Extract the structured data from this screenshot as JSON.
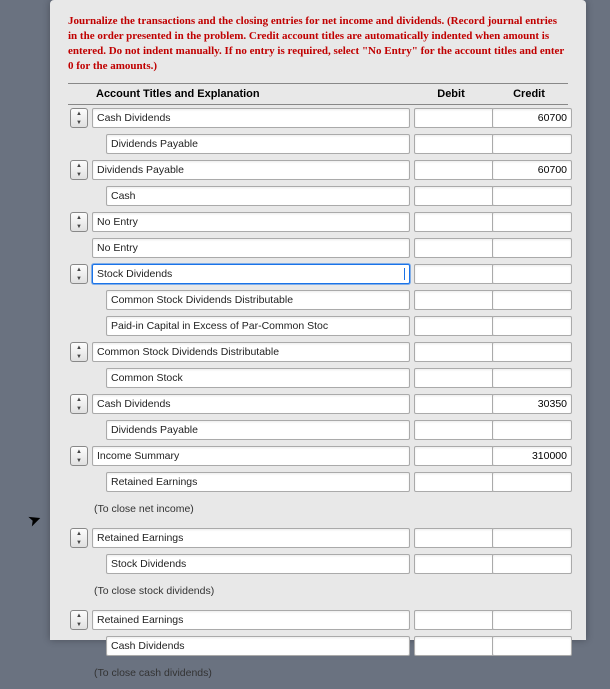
{
  "instructions": "Journalize the transactions and the closing entries for net income and dividends. (Record journal entries in the order presented in the problem. Credit account titles are automatically indented when amount is entered. Do not indent manually. If no entry is required, select \"No Entry\" for the account titles and enter 0 for the amounts.)",
  "headers": {
    "account": "Account Titles and Explanation",
    "debit": "Debit",
    "credit": "Credit"
  },
  "rows": [
    {
      "stepper": true,
      "account": "Cash Dividends",
      "debit": "",
      "credit": "60700"
    },
    {
      "stepper": false,
      "account": "Dividends Payable",
      "indent": true,
      "debit": "",
      "credit": ""
    },
    {
      "stepper": true,
      "account": "Dividends Payable",
      "debit": "",
      "credit": "60700"
    },
    {
      "stepper": false,
      "account": "Cash",
      "indent": true,
      "debit": "",
      "credit": ""
    },
    {
      "stepper": true,
      "account": "No Entry",
      "debit": "",
      "credit": ""
    },
    {
      "stepper": false,
      "account": "No Entry",
      "debit": "",
      "credit": ""
    },
    {
      "stepper": true,
      "account": "Stock Dividends",
      "debit": "",
      "credit": "",
      "focus": true
    },
    {
      "stepper": false,
      "account": "Common Stock Dividends Distributable",
      "indent": true,
      "debit": "",
      "credit": ""
    },
    {
      "stepper": false,
      "account": "Paid-in Capital in Excess of Par-Common Stoc",
      "indent": true,
      "debit": "",
      "credit": ""
    },
    {
      "stepper": true,
      "account": "Common Stock Dividends Distributable",
      "debit": "",
      "credit": ""
    },
    {
      "stepper": false,
      "account": "Common Stock",
      "indent": true,
      "debit": "",
      "credit": ""
    },
    {
      "stepper": true,
      "account": "Cash Dividends",
      "debit": "",
      "credit": "30350"
    },
    {
      "stepper": false,
      "account": "Dividends Payable",
      "indent": true,
      "debit": "",
      "credit": ""
    },
    {
      "stepper": true,
      "account": "Income Summary",
      "debit": "",
      "credit": "310000"
    },
    {
      "stepper": false,
      "account": "Retained Earnings",
      "indent": true,
      "debit": "",
      "credit": ""
    },
    {
      "memo": "(To close net income)"
    },
    {
      "stepper": true,
      "account": "Retained Earnings",
      "debit": "",
      "credit": ""
    },
    {
      "stepper": false,
      "account": "Stock Dividends",
      "indent": true,
      "debit": "",
      "credit": ""
    },
    {
      "memo": "(To close stock dividends)"
    },
    {
      "stepper": true,
      "account": "Retained Earnings",
      "debit": "",
      "credit": ""
    },
    {
      "stepper": false,
      "account": "Cash Dividends",
      "indent": true,
      "debit": "",
      "credit": ""
    },
    {
      "memo": "(To close cash dividends)"
    }
  ]
}
